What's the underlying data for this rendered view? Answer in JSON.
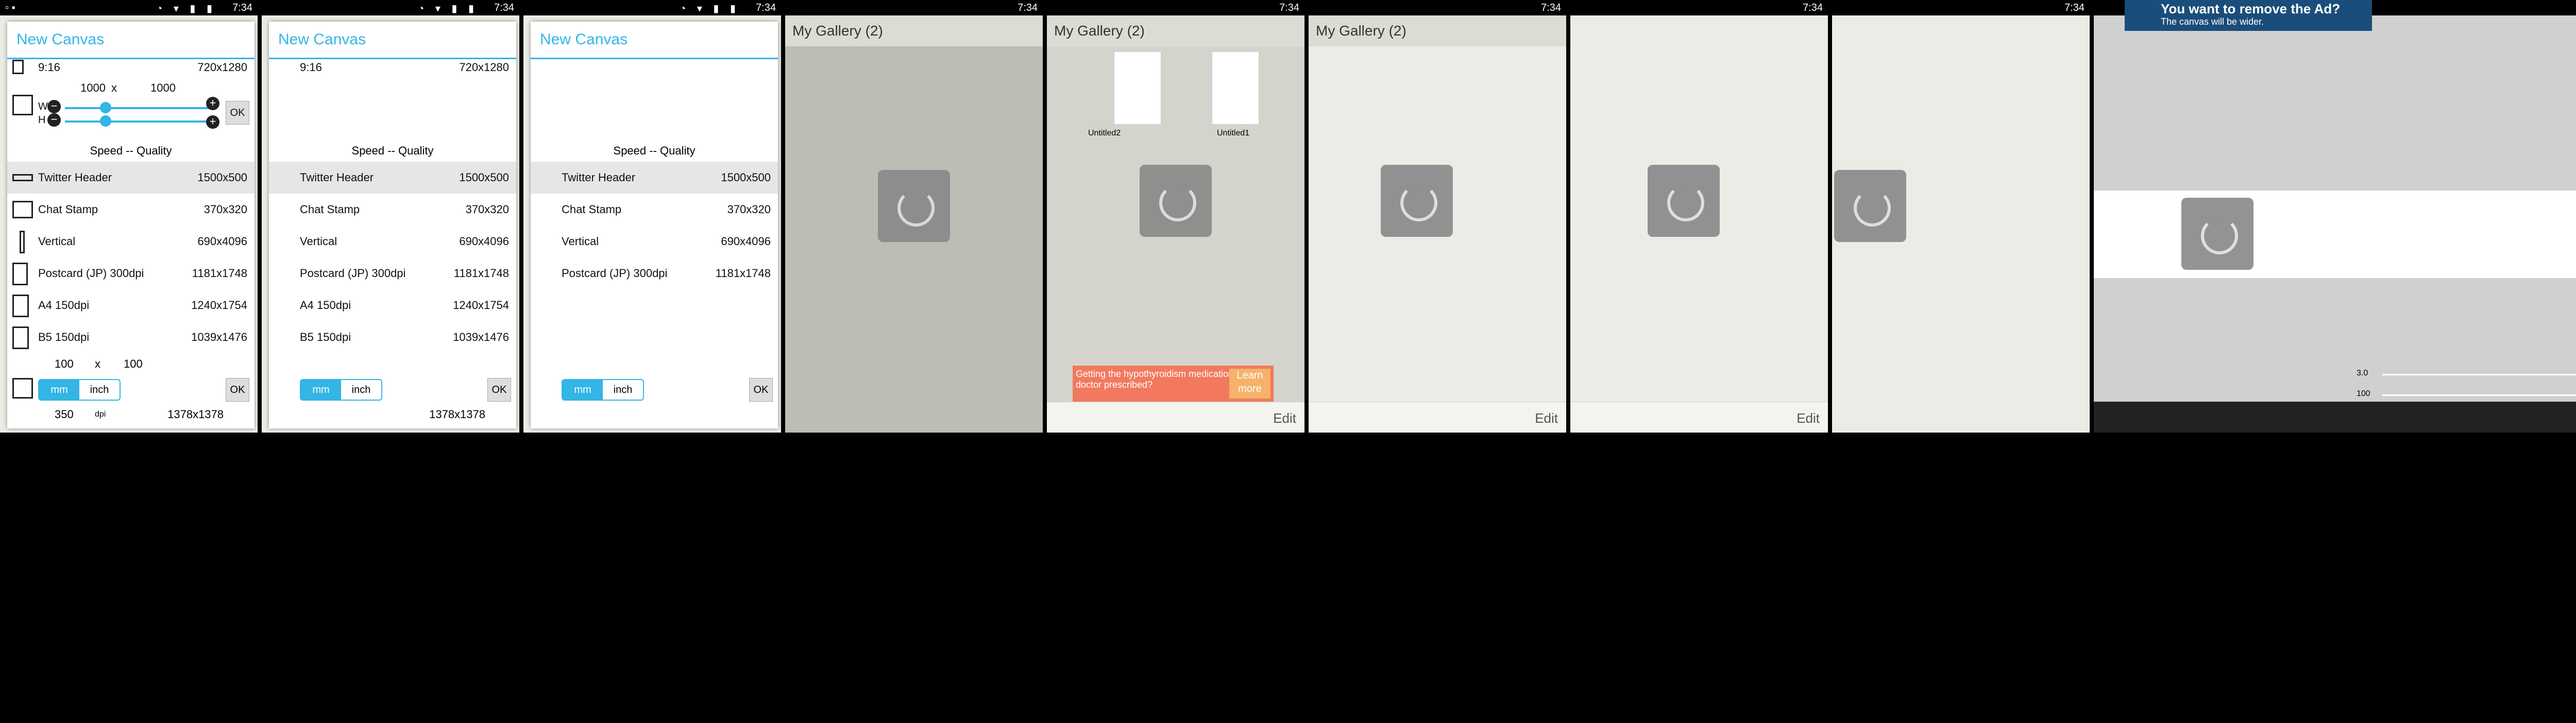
{
  "statusbar": {
    "time": "7:34"
  },
  "dialog": {
    "title": "New Canvas",
    "presets": [
      {
        "name": "9:16",
        "size": "720x1280"
      },
      {
        "name": "Twitter Header",
        "size": "1500x500"
      },
      {
        "name": "Chat Stamp",
        "size": "370x320"
      },
      {
        "name": "Vertical",
        "size": "690x4096"
      },
      {
        "name": "Postcard (JP) 300dpi",
        "size": "1181x1748"
      },
      {
        "name": "A4 150dpi",
        "size": "1240x1754"
      },
      {
        "name": "B5 150dpi",
        "size": "1039x1476"
      }
    ],
    "custom_w": "1000",
    "custom_h": "1000",
    "x_sep": "x",
    "w_label": "W",
    "h_label": "H",
    "speed_quality": "Speed -- Quality",
    "ok": "OK",
    "mm_w": "100",
    "mm_h": "100",
    "unit_mm": "mm",
    "unit_inch": "inch",
    "dpi_value": "350",
    "dpi_label": "dpi",
    "result_size": "1378x1378"
  },
  "gallery": {
    "title": "My Gallery (2)",
    "items": [
      "Untitled2",
      "Untitled1"
    ],
    "edit": "Edit"
  },
  "ad": {
    "text": "Getting the hypothyroidism medication your doctor prescribed?",
    "learn": "Learn more"
  },
  "remove_ad": {
    "title": "You want to remove the Ad?",
    "subtitle": "The canvas will be wider."
  },
  "editor": {
    "value_a": "3.0",
    "value_b": "100"
  }
}
